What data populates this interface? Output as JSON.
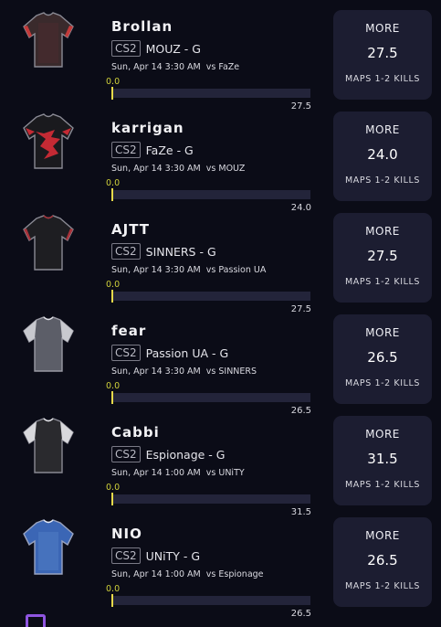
{
  "colors": {
    "background": "#0b0c17",
    "card": "#1c1d31",
    "track": "#23243a",
    "marker": "#e6d94a",
    "zero_label": "#cfd03a"
  },
  "players": [
    {
      "name": "Brollan",
      "game": "CS2",
      "team_line": "MOUZ - G",
      "time": "Sun, Apr 14 3:30 AM",
      "opponent": "vs FaZe",
      "min_label": "0.0",
      "max_label": "27.5",
      "more_label": "MORE",
      "line": "27.5",
      "stat": "MAPS 1-2 KILLS",
      "jersey_icon": "mouz-jersey-icon"
    },
    {
      "name": "karrigan",
      "game": "CS2",
      "team_line": "FaZe - G",
      "time": "Sun, Apr 14 3:30 AM",
      "opponent": "vs MOUZ",
      "min_label": "0.0",
      "max_label": "24.0",
      "more_label": "MORE",
      "line": "24.0",
      "stat": "MAPS 1-2 KILLS",
      "jersey_icon": "faze-jersey-icon"
    },
    {
      "name": "AJTT",
      "game": "CS2",
      "team_line": "SINNERS - G",
      "time": "Sun, Apr 14 3:30 AM",
      "opponent": "vs Passion UA",
      "min_label": "0.0",
      "max_label": "27.5",
      "more_label": "MORE",
      "line": "27.5",
      "stat": "MAPS 1-2 KILLS",
      "jersey_icon": "sinners-jersey-icon"
    },
    {
      "name": "fear",
      "game": "CS2",
      "team_line": "Passion UA - G",
      "time": "Sun, Apr 14 3:30 AM",
      "opponent": "vs SINNERS",
      "min_label": "0.0",
      "max_label": "26.5",
      "more_label": "MORE",
      "line": "26.5",
      "stat": "MAPS 1-2 KILLS",
      "jersey_icon": "passion-ua-jersey-icon"
    },
    {
      "name": "Cabbi",
      "game": "CS2",
      "team_line": "Espionage - G",
      "time": "Sun, Apr 14 1:00 AM",
      "opponent": "vs UNiTY",
      "min_label": "0.0",
      "max_label": "31.5",
      "more_label": "MORE",
      "line": "31.5",
      "stat": "MAPS 1-2 KILLS",
      "jersey_icon": "espionage-jersey-icon"
    },
    {
      "name": "NIO",
      "game": "CS2",
      "team_line": "UNiTY - G",
      "time": "Sun, Apr 14 1:00 AM",
      "opponent": "vs Espionage",
      "min_label": "0.0",
      "max_label": "26.5",
      "more_label": "MORE",
      "line": "26.5",
      "stat": "MAPS 1-2 KILLS",
      "jersey_icon": "unity-jersey-icon"
    }
  ]
}
